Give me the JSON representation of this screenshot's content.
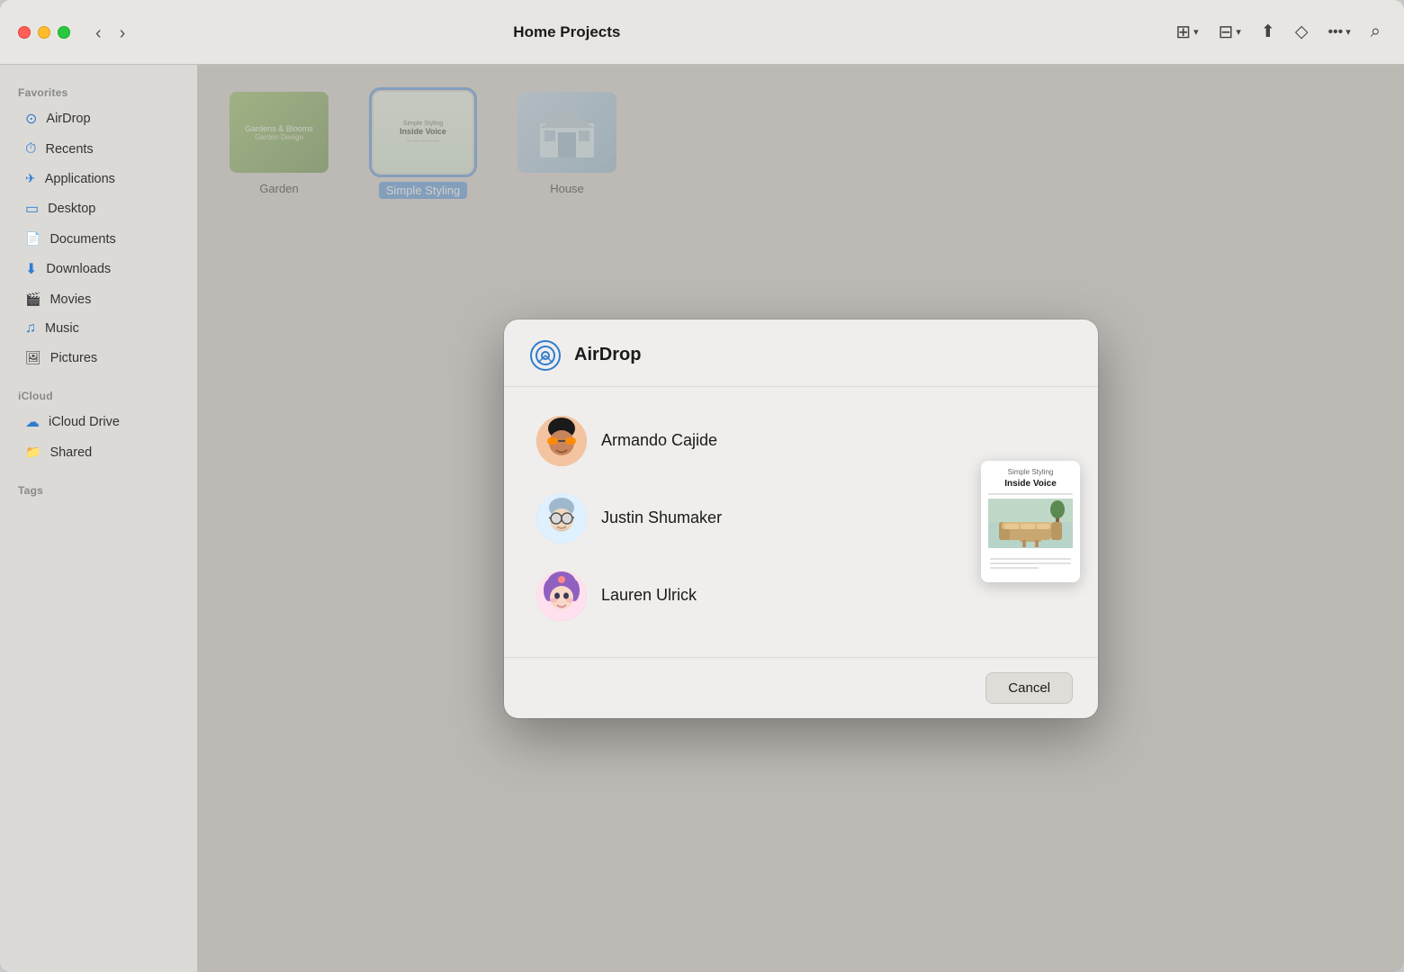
{
  "window": {
    "title": "Home Projects"
  },
  "titlebar": {
    "back_label": "‹",
    "forward_label": "›",
    "title": "Home Projects",
    "view_grid_label": "⊞",
    "view_group_label": "⊟",
    "share_label": "↑",
    "tag_label": "◇",
    "more_label": "•••",
    "search_label": "⌕"
  },
  "sidebar": {
    "favorites_title": "Favorites",
    "icloud_title": "iCloud",
    "tags_title": "Tags",
    "items": [
      {
        "id": "airdrop",
        "icon": "⊙",
        "label": "AirDrop"
      },
      {
        "id": "recents",
        "icon": "⏱",
        "label": "Recents"
      },
      {
        "id": "applications",
        "icon": "✈",
        "label": "Applications"
      },
      {
        "id": "desktop",
        "icon": "▭",
        "label": "Desktop"
      },
      {
        "id": "documents",
        "icon": "📄",
        "label": "Documents"
      },
      {
        "id": "downloads",
        "icon": "⬇",
        "label": "Downloads"
      },
      {
        "id": "movies",
        "icon": "🎬",
        "label": "Movies"
      },
      {
        "id": "music",
        "icon": "♫",
        "label": "Music"
      },
      {
        "id": "pictures",
        "icon": "🖼",
        "label": "Pictures"
      }
    ],
    "icloud_items": [
      {
        "id": "icloud-drive",
        "icon": "☁",
        "label": "iCloud Drive"
      },
      {
        "id": "shared",
        "icon": "📁",
        "label": "Shared"
      }
    ]
  },
  "files": [
    {
      "id": "garden",
      "label": "Garden",
      "selected": false
    },
    {
      "id": "simple-styling",
      "label": "Simple Styling",
      "selected": true
    },
    {
      "id": "house",
      "label": "House",
      "selected": false
    }
  ],
  "modal": {
    "title": "AirDrop",
    "contacts": [
      {
        "id": "armando",
        "name": "Armando Cajide",
        "emoji": "😎"
      },
      {
        "id": "justin",
        "name": "Justin Shumaker",
        "emoji": "🤓"
      },
      {
        "id": "lauren",
        "name": "Lauren Ulrick",
        "emoji": "👩‍🦱"
      }
    ],
    "preview": {
      "subtitle": "Simple Styling",
      "subtitle2": "Inside Voice"
    },
    "cancel_label": "Cancel"
  }
}
